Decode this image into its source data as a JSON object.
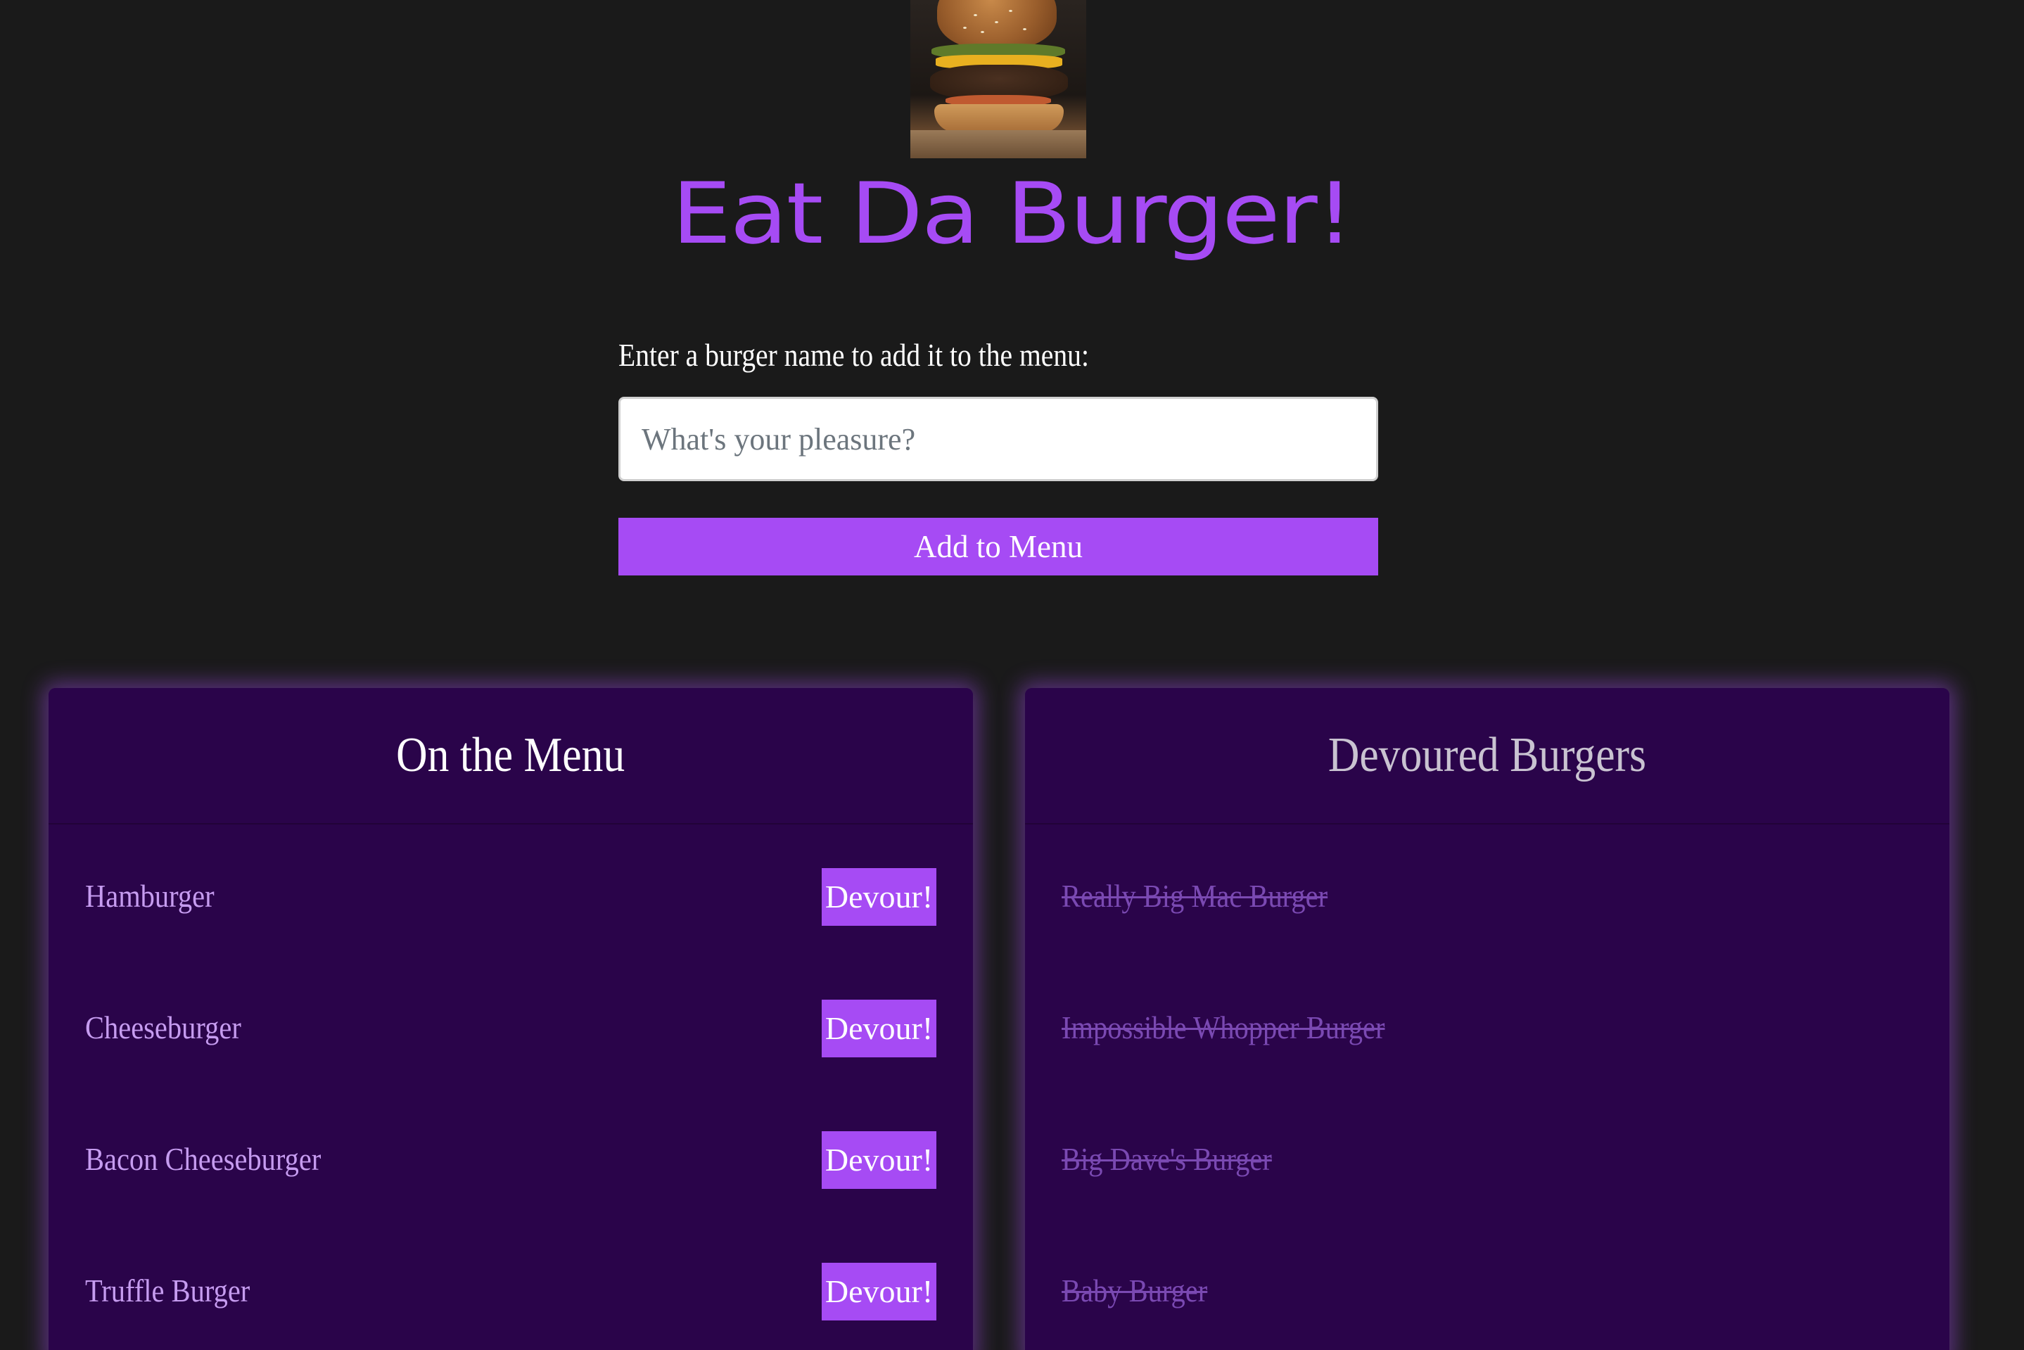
{
  "header": {
    "image_name": "burger-photo",
    "title": "Eat Da Burger!"
  },
  "form": {
    "label": "Enter a burger name to add it to the menu:",
    "input_value": "",
    "input_placeholder": "What's your pleasure?",
    "submit_label": "Add to Menu"
  },
  "menu": {
    "title": "On the Menu",
    "button_label": "Devour!",
    "items": [
      {
        "name": "Hamburger"
      },
      {
        "name": "Cheeseburger"
      },
      {
        "name": "Bacon Cheeseburger"
      },
      {
        "name": "Truffle Burger"
      }
    ]
  },
  "devoured": {
    "title": "Devoured Burgers",
    "items": [
      {
        "name": "Really Big Mac Burger"
      },
      {
        "name": "Impossible Whopper Burger"
      },
      {
        "name": "Big Dave's Burger"
      },
      {
        "name": "Baby Burger"
      }
    ]
  },
  "colors": {
    "background": "#1a1a1a",
    "accent": "#a64bf4",
    "card": "#2a044a",
    "devoured_text": "#7a49b2"
  }
}
